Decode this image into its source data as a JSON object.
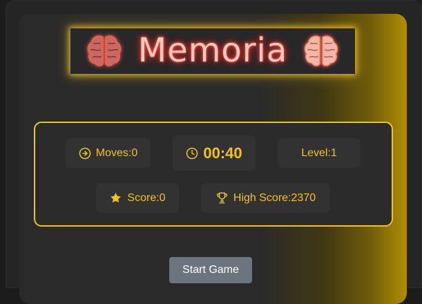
{
  "title": "Memoria",
  "stats": {
    "moves_label": "Moves:",
    "moves_value": "0",
    "timer": "00:40",
    "level_label": "Level:",
    "level_value": "1",
    "score_label": "Score:",
    "score_value": "0",
    "high_score_label": "High Score:",
    "high_score_value": "2370"
  },
  "controls": {
    "start_label": "Start Game"
  },
  "icons": {
    "title_left": "brain-icon",
    "title_right": "brain-icon",
    "moves": "arrow-right-circle-icon",
    "timer": "clock-icon",
    "score": "star-icon",
    "high_score": "trophy-icon"
  },
  "colors": {
    "accent": "#f0c419",
    "title_glow": "#ff4a3a",
    "button": "#6c757d"
  }
}
